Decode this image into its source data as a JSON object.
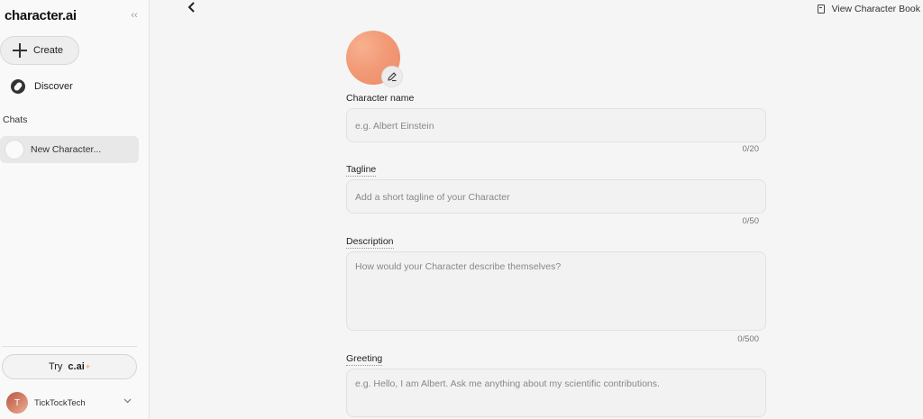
{
  "sidebar": {
    "brand": "character.ai",
    "collapse_glyph": "‹‹",
    "create_label": "Create",
    "discover_label": "Discover",
    "chats_heading": "Chats",
    "chat_items": [
      {
        "label": "New Character..."
      }
    ],
    "try_prefix": "Try",
    "try_brand": "c.ai",
    "try_suffix": "+",
    "user": {
      "initial": "T",
      "name": "TickTockTech"
    }
  },
  "header": {
    "back_glyph": "‹",
    "view_book_label": "View Character Book"
  },
  "form": {
    "name": {
      "label": "Character name",
      "placeholder": "e.g. Albert Einstein",
      "counter": "0/20"
    },
    "tagline": {
      "label": "Tagline",
      "placeholder": "Add a short tagline of your Character",
      "counter": "0/50"
    },
    "description": {
      "label": "Description",
      "placeholder": "How would your Character describe themselves?",
      "counter": "0/500"
    },
    "greeting": {
      "label": "Greeting",
      "placeholder": "e.g. Hello, I am Albert. Ask me anything about my scientific contributions."
    }
  },
  "colors": {
    "accent_avatar": "#f29a77",
    "page_bg": "#f5f5f5",
    "sidebar_bg": "#f9f9f9",
    "plus_accent": "#e59b3e"
  },
  "icons": [
    "collapse-icon",
    "plus-icon",
    "compass-icon",
    "book-icon",
    "back-icon",
    "pencil-icon",
    "chevron-down-icon"
  ]
}
